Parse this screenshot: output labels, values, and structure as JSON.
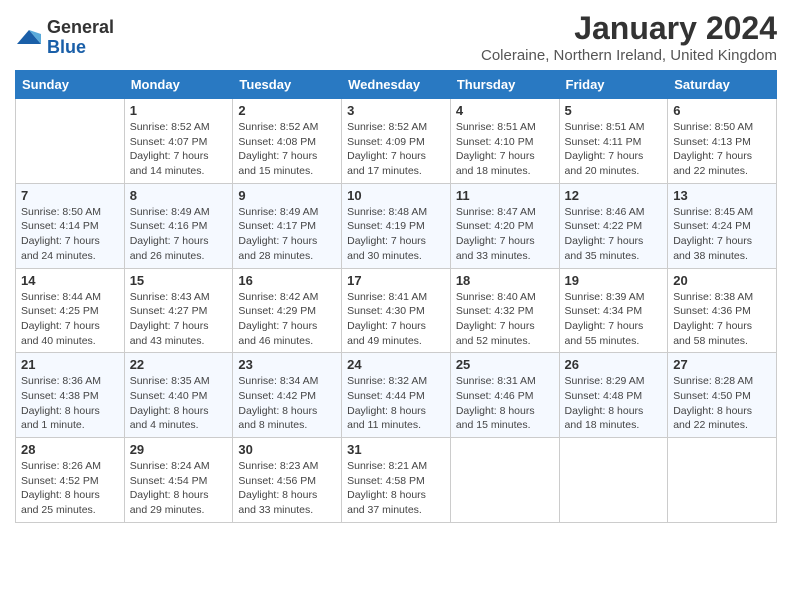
{
  "logo": {
    "general": "General",
    "blue": "Blue"
  },
  "title": "January 2024",
  "location": "Coleraine, Northern Ireland, United Kingdom",
  "days": [
    "Sunday",
    "Monday",
    "Tuesday",
    "Wednesday",
    "Thursday",
    "Friday",
    "Saturday"
  ],
  "weeks": [
    [
      {
        "date": "",
        "sunrise": "",
        "sunset": "",
        "daylight": ""
      },
      {
        "date": "1",
        "sunrise": "Sunrise: 8:52 AM",
        "sunset": "Sunset: 4:07 PM",
        "daylight": "Daylight: 7 hours and 14 minutes."
      },
      {
        "date": "2",
        "sunrise": "Sunrise: 8:52 AM",
        "sunset": "Sunset: 4:08 PM",
        "daylight": "Daylight: 7 hours and 15 minutes."
      },
      {
        "date": "3",
        "sunrise": "Sunrise: 8:52 AM",
        "sunset": "Sunset: 4:09 PM",
        "daylight": "Daylight: 7 hours and 17 minutes."
      },
      {
        "date": "4",
        "sunrise": "Sunrise: 8:51 AM",
        "sunset": "Sunset: 4:10 PM",
        "daylight": "Daylight: 7 hours and 18 minutes."
      },
      {
        "date": "5",
        "sunrise": "Sunrise: 8:51 AM",
        "sunset": "Sunset: 4:11 PM",
        "daylight": "Daylight: 7 hours and 20 minutes."
      },
      {
        "date": "6",
        "sunrise": "Sunrise: 8:50 AM",
        "sunset": "Sunset: 4:13 PM",
        "daylight": "Daylight: 7 hours and 22 minutes."
      }
    ],
    [
      {
        "date": "7",
        "sunrise": "Sunrise: 8:50 AM",
        "sunset": "Sunset: 4:14 PM",
        "daylight": "Daylight: 7 hours and 24 minutes."
      },
      {
        "date": "8",
        "sunrise": "Sunrise: 8:49 AM",
        "sunset": "Sunset: 4:16 PM",
        "daylight": "Daylight: 7 hours and 26 minutes."
      },
      {
        "date": "9",
        "sunrise": "Sunrise: 8:49 AM",
        "sunset": "Sunset: 4:17 PM",
        "daylight": "Daylight: 7 hours and 28 minutes."
      },
      {
        "date": "10",
        "sunrise": "Sunrise: 8:48 AM",
        "sunset": "Sunset: 4:19 PM",
        "daylight": "Daylight: 7 hours and 30 minutes."
      },
      {
        "date": "11",
        "sunrise": "Sunrise: 8:47 AM",
        "sunset": "Sunset: 4:20 PM",
        "daylight": "Daylight: 7 hours and 33 minutes."
      },
      {
        "date": "12",
        "sunrise": "Sunrise: 8:46 AM",
        "sunset": "Sunset: 4:22 PM",
        "daylight": "Daylight: 7 hours and 35 minutes."
      },
      {
        "date": "13",
        "sunrise": "Sunrise: 8:45 AM",
        "sunset": "Sunset: 4:24 PM",
        "daylight": "Daylight: 7 hours and 38 minutes."
      }
    ],
    [
      {
        "date": "14",
        "sunrise": "Sunrise: 8:44 AM",
        "sunset": "Sunset: 4:25 PM",
        "daylight": "Daylight: 7 hours and 40 minutes."
      },
      {
        "date": "15",
        "sunrise": "Sunrise: 8:43 AM",
        "sunset": "Sunset: 4:27 PM",
        "daylight": "Daylight: 7 hours and 43 minutes."
      },
      {
        "date": "16",
        "sunrise": "Sunrise: 8:42 AM",
        "sunset": "Sunset: 4:29 PM",
        "daylight": "Daylight: 7 hours and 46 minutes."
      },
      {
        "date": "17",
        "sunrise": "Sunrise: 8:41 AM",
        "sunset": "Sunset: 4:30 PM",
        "daylight": "Daylight: 7 hours and 49 minutes."
      },
      {
        "date": "18",
        "sunrise": "Sunrise: 8:40 AM",
        "sunset": "Sunset: 4:32 PM",
        "daylight": "Daylight: 7 hours and 52 minutes."
      },
      {
        "date": "19",
        "sunrise": "Sunrise: 8:39 AM",
        "sunset": "Sunset: 4:34 PM",
        "daylight": "Daylight: 7 hours and 55 minutes."
      },
      {
        "date": "20",
        "sunrise": "Sunrise: 8:38 AM",
        "sunset": "Sunset: 4:36 PM",
        "daylight": "Daylight: 7 hours and 58 minutes."
      }
    ],
    [
      {
        "date": "21",
        "sunrise": "Sunrise: 8:36 AM",
        "sunset": "Sunset: 4:38 PM",
        "daylight": "Daylight: 8 hours and 1 minute."
      },
      {
        "date": "22",
        "sunrise": "Sunrise: 8:35 AM",
        "sunset": "Sunset: 4:40 PM",
        "daylight": "Daylight: 8 hours and 4 minutes."
      },
      {
        "date": "23",
        "sunrise": "Sunrise: 8:34 AM",
        "sunset": "Sunset: 4:42 PM",
        "daylight": "Daylight: 8 hours and 8 minutes."
      },
      {
        "date": "24",
        "sunrise": "Sunrise: 8:32 AM",
        "sunset": "Sunset: 4:44 PM",
        "daylight": "Daylight: 8 hours and 11 minutes."
      },
      {
        "date": "25",
        "sunrise": "Sunrise: 8:31 AM",
        "sunset": "Sunset: 4:46 PM",
        "daylight": "Daylight: 8 hours and 15 minutes."
      },
      {
        "date": "26",
        "sunrise": "Sunrise: 8:29 AM",
        "sunset": "Sunset: 4:48 PM",
        "daylight": "Daylight: 8 hours and 18 minutes."
      },
      {
        "date": "27",
        "sunrise": "Sunrise: 8:28 AM",
        "sunset": "Sunset: 4:50 PM",
        "daylight": "Daylight: 8 hours and 22 minutes."
      }
    ],
    [
      {
        "date": "28",
        "sunrise": "Sunrise: 8:26 AM",
        "sunset": "Sunset: 4:52 PM",
        "daylight": "Daylight: 8 hours and 25 minutes."
      },
      {
        "date": "29",
        "sunrise": "Sunrise: 8:24 AM",
        "sunset": "Sunset: 4:54 PM",
        "daylight": "Daylight: 8 hours and 29 minutes."
      },
      {
        "date": "30",
        "sunrise": "Sunrise: 8:23 AM",
        "sunset": "Sunset: 4:56 PM",
        "daylight": "Daylight: 8 hours and 33 minutes."
      },
      {
        "date": "31",
        "sunrise": "Sunrise: 8:21 AM",
        "sunset": "Sunset: 4:58 PM",
        "daylight": "Daylight: 8 hours and 37 minutes."
      },
      {
        "date": "",
        "sunrise": "",
        "sunset": "",
        "daylight": ""
      },
      {
        "date": "",
        "sunrise": "",
        "sunset": "",
        "daylight": ""
      },
      {
        "date": "",
        "sunrise": "",
        "sunset": "",
        "daylight": ""
      }
    ]
  ]
}
